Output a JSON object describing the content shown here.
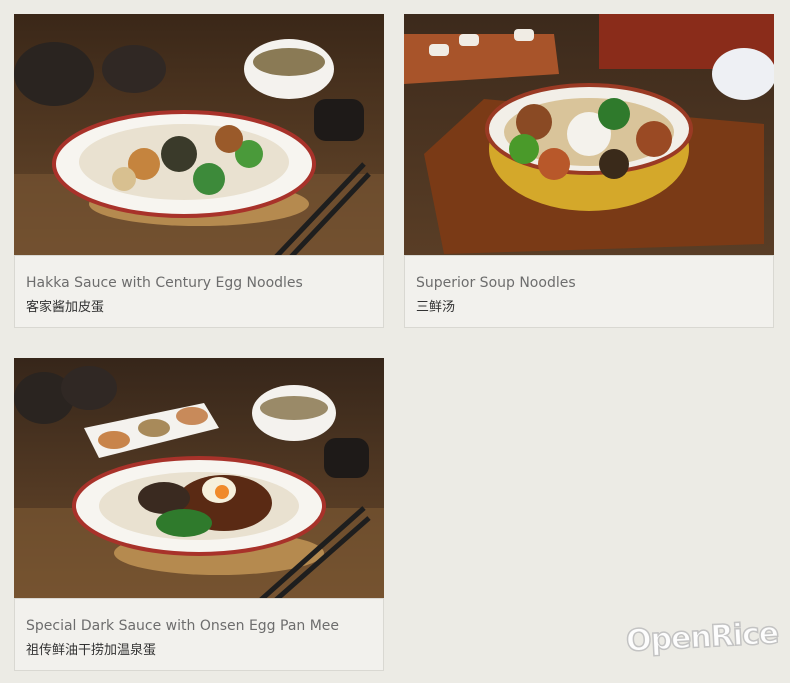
{
  "menu": {
    "items": [
      {
        "title": "Hakka Sauce with Century Egg Noodles",
        "subtitle": "客家酱加皮蛋"
      },
      {
        "title": "Superior Soup Noodles",
        "subtitle": "三鲜汤"
      },
      {
        "title": "Special Dark Sauce with Onsen Egg Pan Mee",
        "subtitle": "祖传鲜油干捞加温泉蛋"
      }
    ]
  },
  "watermark": {
    "text": "OpenRice"
  },
  "colors": {
    "page_background": "#ecebe5",
    "card_background": "#f2f1ed",
    "card_border": "#d9d8d2",
    "title_text": "#6d6d6d",
    "subtitle_text": "#333333"
  }
}
